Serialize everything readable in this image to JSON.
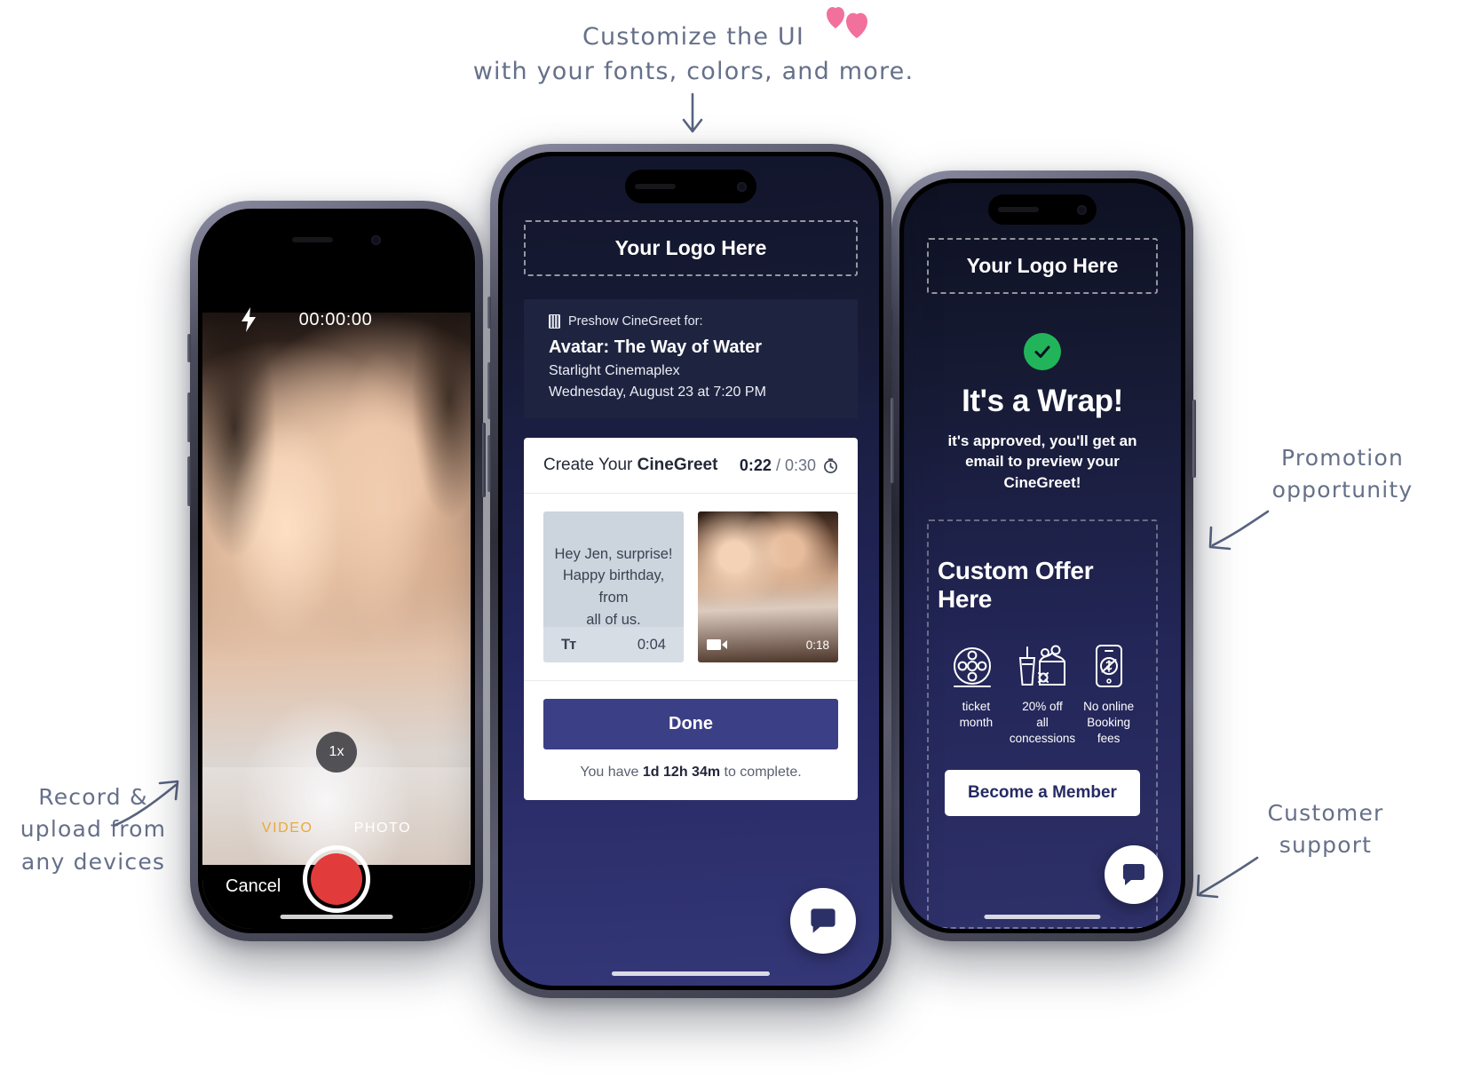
{
  "annotations": {
    "top": "Customize the UI\nwith your fonts, colors, and more.",
    "left": "Record &\nupload from\nany devices",
    "right_top": "Promotion\nopportunity",
    "right_bottom": "Customer\nsupport"
  },
  "colors": {
    "navy": "#242760",
    "dark_navy": "#1e2440",
    "accent_button": "#3b3f85",
    "success_green": "#22b45a",
    "record_red": "#e13b3b",
    "mode_active": "#e9a93a",
    "heart_pink": "#f2709c",
    "annotation_ink": "#596480"
  },
  "left_phone": {
    "name": "camera-capture-screen",
    "flash_icon": "flash-bolt-icon",
    "timer": "00:00:00",
    "zoom_level": "1x",
    "modes": [
      {
        "label": "VIDEO",
        "active": true
      },
      {
        "label": "PHOTO",
        "active": false
      }
    ],
    "cancel_label": "Cancel",
    "shutter_icon": "record-button-icon"
  },
  "center_phone": {
    "name": "create-cinegreet-screen",
    "logo_placeholder": "Your Logo Here",
    "ticket": {
      "icon": "film-ticket-icon",
      "eyebrow": "Preshow CineGreet for:",
      "movie": "Avatar: The Way of Water",
      "venue": "Starlight Cinemaplex",
      "showtime": "Wednesday, August 23 at 7:20 PM"
    },
    "card": {
      "title_prefix": "Create Your ",
      "title_brand": "CineGreet",
      "time_used": "0:22",
      "time_total": "/ 0:30",
      "timer_icon": "stopwatch-icon",
      "clips": [
        {
          "type": "text",
          "text": "Hey Jen, surprise!\nHappy birthday, from\nall of us.",
          "icon": "text-tool-icon",
          "icon_glyph": "Tт",
          "duration": "0:04"
        },
        {
          "type": "video",
          "icon": "video-camera-icon",
          "duration": "0:18"
        }
      ],
      "done_label": "Done",
      "note_prefix": "You have ",
      "note_bold": "1d 12h 34m",
      "note_suffix": " to complete."
    },
    "chat_fab_icon": "chat-bubble-icon"
  },
  "right_phone": {
    "name": "confirmation-screen",
    "logo_placeholder": "Your Logo Here",
    "status_icon": "check-circle-icon",
    "title": "It's a Wrap!",
    "subtitle": "it's approved, you'll get an email to\npreview your CineGreet!",
    "offer_title": "Custom Offer Here",
    "offers": [
      {
        "icon": "film-reel-icon",
        "line1": "ticket",
        "line2": "month"
      },
      {
        "icon": "popcorn-drink-icon",
        "line1": "20% off",
        "line2": "all concessions"
      },
      {
        "icon": "phone-no-fee-icon",
        "line1": "No online",
        "line2": "Booking fees"
      }
    ],
    "member_button": "Become a Member",
    "chat_fab_icon": "chat-bubble-icon"
  }
}
